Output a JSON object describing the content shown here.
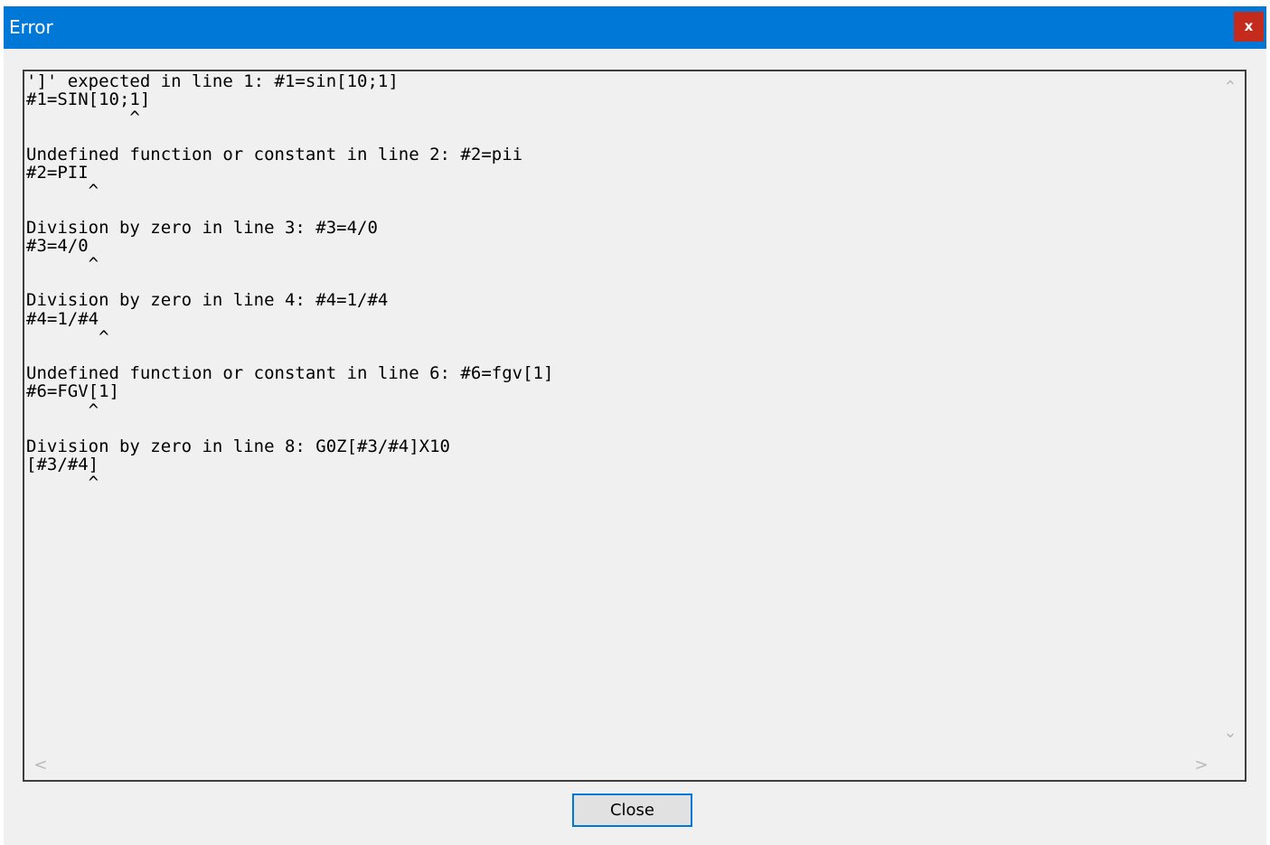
{
  "window": {
    "title": "Error",
    "close_icon_glyph": "x"
  },
  "error_text": {
    "lines": [
      "']' expected in line 1: #1=sin[10;1]",
      "#1=SIN[10;1]",
      "          ^",
      "",
      "Undefined function or constant in line 2: #2=pii",
      "#2=PII",
      "      ^",
      "",
      "Division by zero in line 3: #3=4/0",
      "#3=4/0",
      "      ^",
      "",
      "Division by zero in line 4: #4=1/#4",
      "#4=1/#4",
      "       ^",
      "",
      "Undefined function or constant in line 6: #6=fgv[1]",
      "#6=FGV[1]",
      "      ^",
      "",
      "Division by zero in line 8: G0Z[#3/#4]X10",
      "[#3/#4]",
      "      ^"
    ]
  },
  "scrollbars": {
    "up_glyph": "⌃",
    "down_glyph": "⌄",
    "left_glyph": "<",
    "right_glyph": ">"
  },
  "buttons": {
    "close_label": "Close"
  },
  "colors": {
    "titlebar": "#0078d7",
    "close_x_bg": "#c42b1c",
    "dialog_bg": "#f0f0f0"
  }
}
